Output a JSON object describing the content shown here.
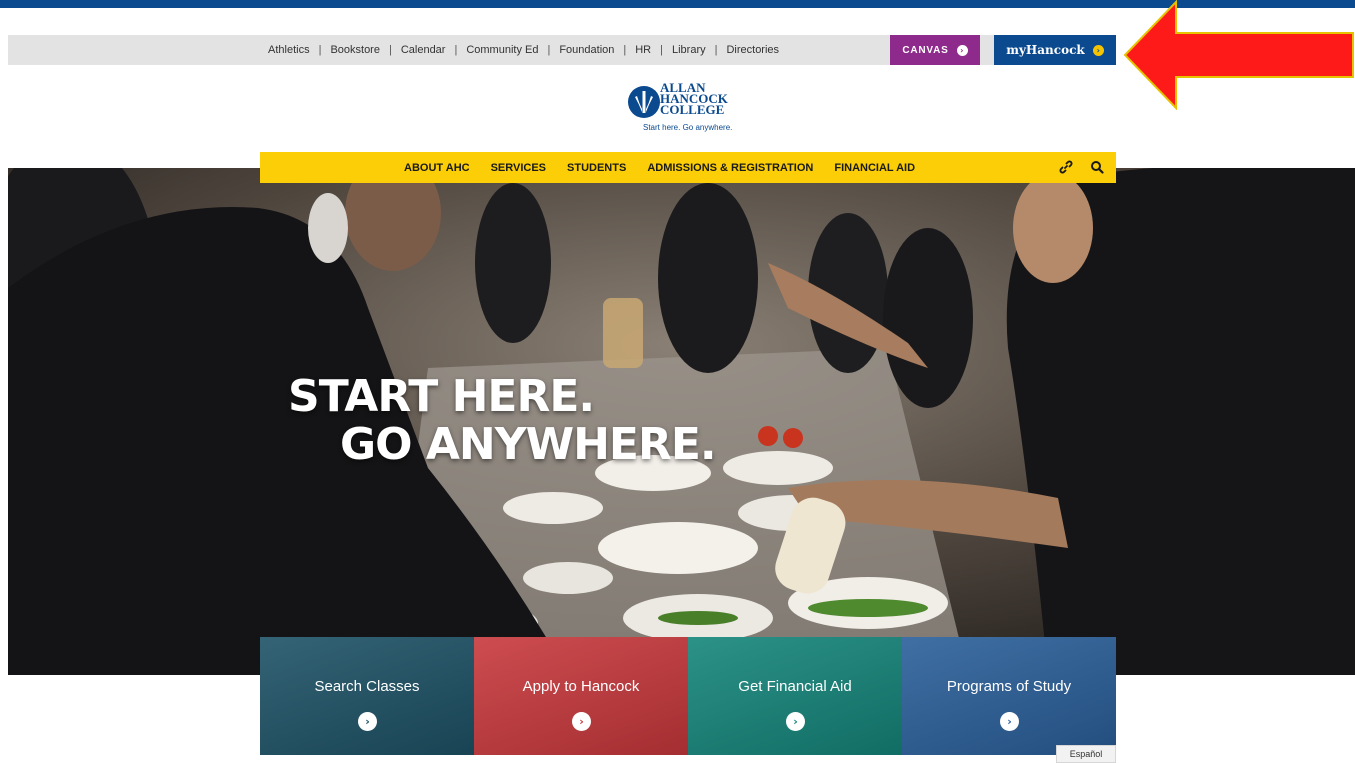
{
  "utility_nav": {
    "links": [
      "Athletics",
      "Bookstore",
      "Calendar",
      "Community Ed",
      "Foundation",
      "HR",
      "Library",
      "Directories"
    ],
    "separator": "|",
    "canvas_label": "CANVAS",
    "myhancock_label": "myHancock",
    "arrow_glyph": "›"
  },
  "logo": {
    "line1": "ALLAN",
    "line2": "HANCOCK",
    "line3": "COLLEGE",
    "tagline": "Start here. Go anywhere."
  },
  "main_nav": {
    "items": [
      "ABOUT AHC",
      "SERVICES",
      "STUDENTS",
      "ADMISSIONS & REGISTRATION",
      "FINANCIAL AID"
    ]
  },
  "hero": {
    "headline_line1": "START HERE.",
    "headline_line2": "GO ANYWHERE."
  },
  "tiles": [
    {
      "label": "Search Classes",
      "color": "#1d5266"
    },
    {
      "label": "Apply to Hancock",
      "color": "#c8383c"
    },
    {
      "label": "Get Financial Aid",
      "color": "#14857a"
    },
    {
      "label": "Programs of Study",
      "color": "#2a5f9a"
    }
  ],
  "tile_arrow": "›",
  "language_toggle": "Español",
  "colors": {
    "brand_blue": "#0b4a8f",
    "canvas_purple": "#8e2a8b",
    "nav_yellow": "#fbce07",
    "annotation_red": "#ff1a1a"
  }
}
